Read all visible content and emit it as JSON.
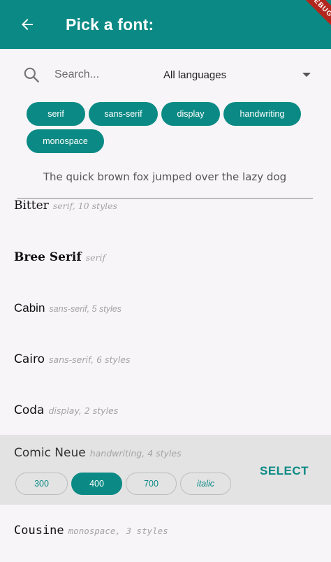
{
  "app_bar": {
    "title": "Pick a font:",
    "debug_banner": "DEBUG"
  },
  "search": {
    "placeholder": "Search..."
  },
  "language_select": {
    "value": "All languages"
  },
  "category_chips": [
    "serif",
    "sans-serif",
    "display",
    "handwriting",
    "monospace"
  ],
  "sample_text": "The quick brown fox jumped over the lazy dog",
  "fonts": [
    {
      "name": "Bitter",
      "meta": "serif, 10 styles"
    },
    {
      "name": "Bree Serif",
      "meta": "serif"
    },
    {
      "name": "Cabin",
      "meta": "sans-serif, 5 styles"
    },
    {
      "name": "Cairo",
      "meta": "sans-serif, 6 styles"
    },
    {
      "name": "Coda",
      "meta": "display, 2 styles"
    },
    {
      "name": "Comic Neue",
      "meta": "handwriting, 4 styles"
    },
    {
      "name": "Cousine",
      "meta": "monospace, 3 styles"
    }
  ],
  "selected_font": {
    "select_label": "SELECT",
    "styles": [
      "300",
      "400",
      "700",
      "italic"
    ],
    "active_style": "400"
  },
  "colors": {
    "primary": "#0b8a85",
    "selected_bg": "#e3e3e3",
    "background": "#f7f5f8"
  }
}
